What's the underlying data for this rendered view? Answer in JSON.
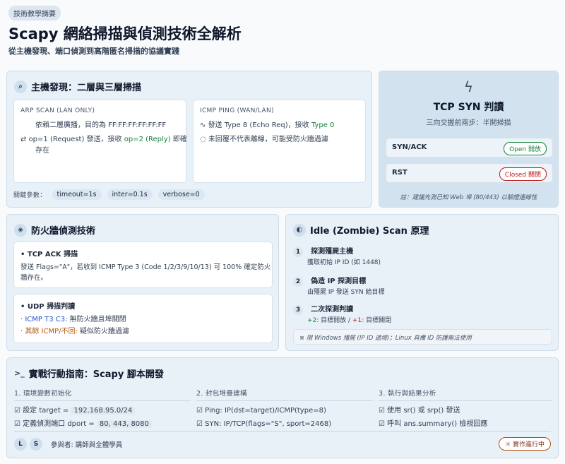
{
  "header": {
    "tag": "技術教學摘要",
    "title": "Scapy 網絡掃描與偵測技術全解析",
    "subtitle": "從主機發現、端口偵測到高階匿名掃描的協議實踐"
  },
  "host_discovery": {
    "title": "主機發現：二層與三層掃描",
    "arp": {
      "heading": "ARP SCAN (LAN ONLY)",
      "line1": "依賴二層廣播，目的為 FF:FF:FF:FF:FF:FF",
      "line2_prefix": "op=1 (Request) 發送，接收 ",
      "line2_hl": "op=2 (Reply)",
      "line2_suffix": " 即確",
      "line3": "存在"
    },
    "icmp": {
      "heading": "ICMP PING (WAN/LAN)",
      "line1_prefix": "發送 Type 8 (Echo Req)，接收 ",
      "line1_hl": "Type 0",
      "line2": "未回覆不代表離線，可能受防火牆過濾"
    },
    "params_label": "關鍵參數：",
    "params": [
      "timeout=1s",
      "inter=0.1s",
      "verbose=0"
    ]
  },
  "tcp_syn": {
    "title": "TCP SYN 判讀",
    "subtitle": "三向交握前兩步：半開掃描",
    "rows": [
      {
        "label": "SYN/ACK",
        "badge": "Open 開放"
      },
      {
        "label": "RST",
        "badge": "Closed 關閉"
      }
    ],
    "note": "註：建議先測已知 Web 埠 (80/443) 以驗證連線性"
  },
  "firewall": {
    "title": "防火牆偵測技術",
    "ack_title": "TCP ACK 掃描",
    "ack_line1": "發送 Flags=\"A\"，若收到 ICMP Type 3 (Code 1/2/3/9/10/13) 可 100% 確定防火",
    "ack_line2": "牆存在。",
    "udp_title": "UDP 掃描判讀",
    "udp_item1_hl": "ICMP T3 C3:",
    "udp_item1": " 無防火牆且埠關閉",
    "udp_item2_hl": "其餘 ICMP/不回:",
    "udp_item2": " 疑似防火牆過濾"
  },
  "idle": {
    "title": "Idle (Zombie) Scan 原理",
    "steps": [
      {
        "n": "1",
        "title": "探測殭屍主機",
        "desc": "獲取初始 IP ID (如 1448)"
      },
      {
        "n": "2",
        "title": "偽造 IP 探測目標",
        "desc": "由殭屍 IP 發送 SYN 給目標"
      },
      {
        "n": "3",
        "title": "二次探測判讀",
        "desc_a": "+2:",
        "desc_b": " 目標開放 / ",
        "desc_c": "+1:",
        "desc_d": " 目標關閉"
      }
    ],
    "note": "※ 限 Windows 殭屍 (IP ID 遞增)；Linux 具備 ID 防護無法使用"
  },
  "guide": {
    "title": "實戰行動指南：Scapy 腳本開發",
    "col1_head": "1. 環境變數初始化",
    "col1_l1_prefix": "設定 target = ",
    "col1_l1_hl": "192.168.95.0/24",
    "col1_l2_prefix": "定義偵測端口 dport = ",
    "col1_l2_hl": "80, 443, 8080",
    "col2_head": "2. 封包堆疊建構",
    "col2_l1": "Ping: IP(dst=target)/ICMP(type=8)",
    "col2_l2": "SYN: IP/TCP(flags=\"S\", sport=2468)",
    "col3_head": "3. 執行與結果分析",
    "col3_l1": "使用 sr() 或 srp() 發送",
    "col3_l2": "呼叫 ans.summary() 檢視回應",
    "avatar1": "L",
    "avatar2": "S",
    "participants": "參與者: 講師與全體學員",
    "status": "實作進行中"
  },
  "colors": {
    "accent": "#d2e2ef",
    "open": "#15803d",
    "closed": "#b91c1c",
    "warn": "#b45309"
  }
}
